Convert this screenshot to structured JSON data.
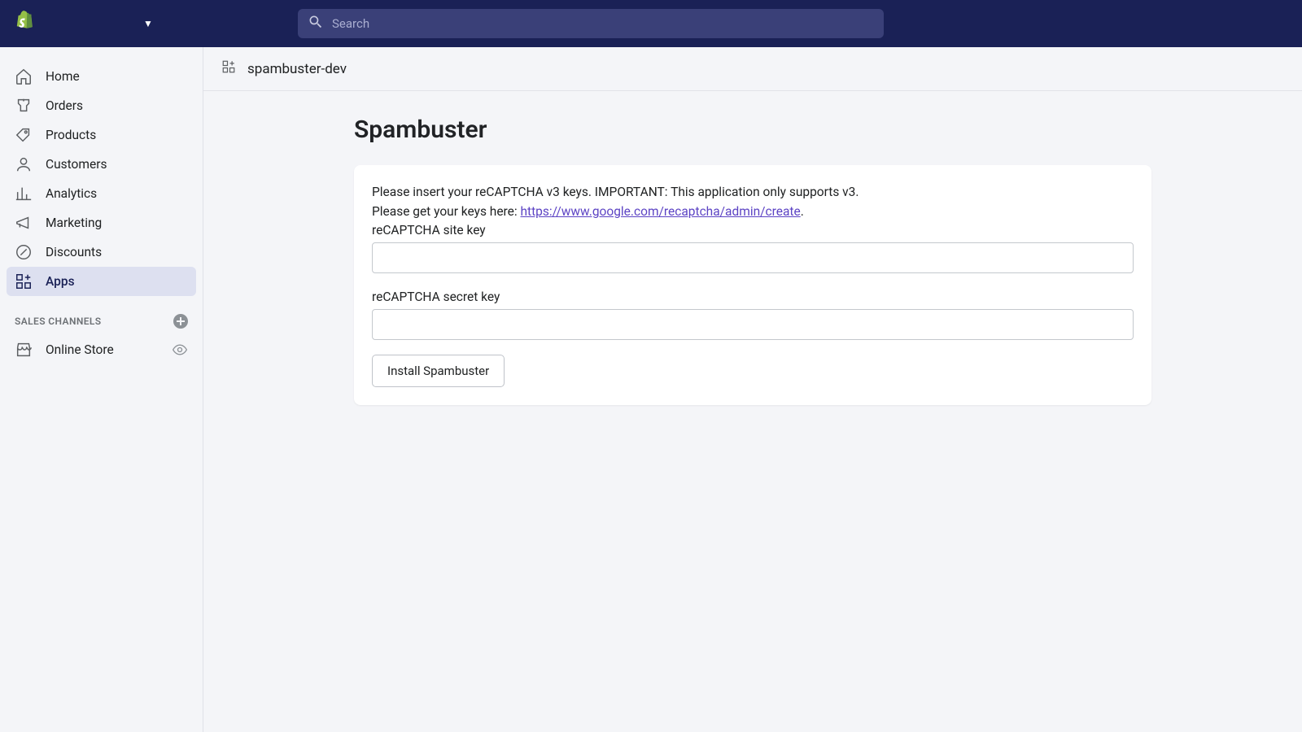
{
  "topbar": {
    "search_placeholder": "Search"
  },
  "sidebar": {
    "items": [
      {
        "label": "Home"
      },
      {
        "label": "Orders"
      },
      {
        "label": "Products"
      },
      {
        "label": "Customers"
      },
      {
        "label": "Analytics"
      },
      {
        "label": "Marketing"
      },
      {
        "label": "Discounts"
      },
      {
        "label": "Apps"
      }
    ],
    "sales_channels_label": "SALES CHANNELS",
    "channels": [
      {
        "label": "Online Store"
      }
    ]
  },
  "breadcrumb": {
    "app_name": "spambuster-dev"
  },
  "page": {
    "title": "Spambuster",
    "intro_line1": "Please insert your reCAPTCHA v3 keys. IMPORTANT: This application only supports v3.",
    "intro_line2_prefix": "Please get your keys here: ",
    "intro_link_text": "https://www.google.com/recaptcha/admin/create",
    "intro_line2_suffix": ".",
    "site_key_label": "reCAPTCHA site key",
    "secret_key_label": "reCAPTCHA secret key",
    "install_button": "Install Spambuster"
  }
}
